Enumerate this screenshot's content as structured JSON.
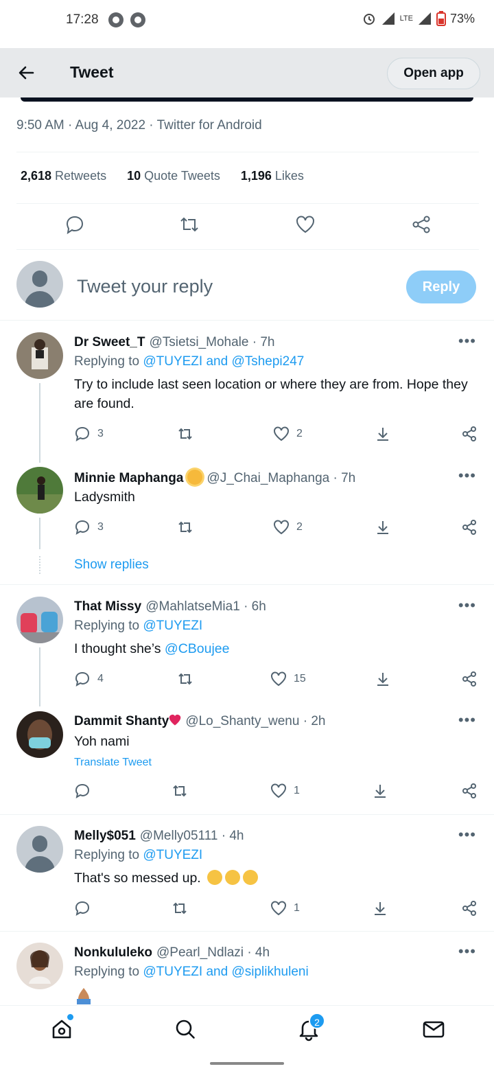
{
  "status_bar": {
    "time": "17:28",
    "network": "LTE",
    "battery": "73%"
  },
  "header": {
    "title": "Tweet",
    "open_app": "Open app"
  },
  "tweet_meta": {
    "timestamp": "9:50 AM · Aug 4, 2022 · Twitter for Android"
  },
  "stats": [
    {
      "count": "2,618",
      "label": "Retweets"
    },
    {
      "count": "10",
      "label": "Quote Tweets"
    },
    {
      "count": "1,196",
      "label": "Likes"
    }
  ],
  "reply_box": {
    "placeholder": "Tweet your reply",
    "button": "Reply"
  },
  "replies": [
    {
      "name": "Dr Sweet_T",
      "handle": "@Tsietsi_Mohale",
      "time": "· 7h",
      "replying_prefix": "Replying to ",
      "replying_to": "@TUYEZI and @Tshepi247",
      "text": "Try to include last seen location or where they are from. Hope they are found.",
      "replies": "3",
      "likes": "2"
    },
    {
      "name": "Minnie Maphanga",
      "handle": "@J_Chai_Maphanga",
      "time": "· 7h",
      "text": "Ladysmith",
      "replies": "3",
      "likes": "2"
    },
    {
      "name": "That Missy",
      "handle": "@MahlatseMia1",
      "time": "· 6h",
      "replying_prefix": "Replying to ",
      "replying_to": "@TUYEZI",
      "text_prefix": "I thought she’s ",
      "text_mention": "@CBoujee",
      "replies": "4",
      "likes": "15"
    },
    {
      "name": "Dammit Shanty",
      "handle": "@Lo_Shanty_wenu",
      "time": "· 2h",
      "text": "Yoh nami",
      "translate": "Translate Tweet",
      "likes": "1"
    },
    {
      "name": "Melly$051",
      "handle": "@Melly05111",
      "time": "· 4h",
      "replying_prefix": "Replying to ",
      "replying_to": "@TUYEZI",
      "text": "That's so messed up.",
      "likes": "1"
    },
    {
      "name": "Nonkululeko",
      "handle": "@Pearl_Ndlazi",
      "time": "· 4h",
      "replying_prefix": "Replying to ",
      "replying_to": "@TUYEZI and @siplikhuleni"
    }
  ],
  "show_replies": "Show replies",
  "more_menu": "•••",
  "bottom_nav": {
    "notifications_badge": "2"
  },
  "colors": {
    "accent": "#1d9bf0",
    "reply_button_disabled": "#8ecdf8",
    "text_secondary": "#536471"
  }
}
